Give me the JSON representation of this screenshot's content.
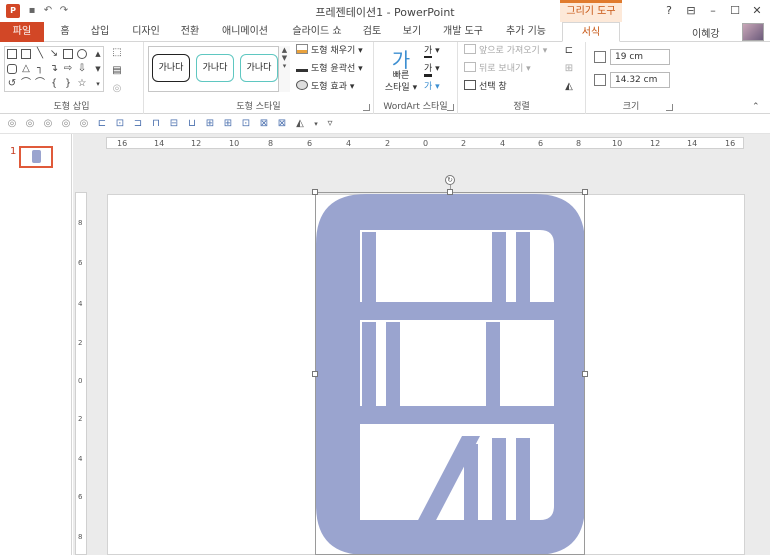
{
  "titlebar": {
    "app_icon": "P",
    "title": "프레젠테이션1 - PowerPoint",
    "context_tab_group": "그리기 도구",
    "help_icon": "?",
    "window_buttons": [
      "?",
      "⊟",
      "–",
      "☐",
      "✕"
    ]
  },
  "tabs": {
    "file": "파일",
    "items": [
      "홈",
      "삽입",
      "디자인",
      "전환",
      "애니메이션",
      "슬라이드 쇼",
      "검토",
      "보기",
      "개발 도구",
      "추가 기능",
      "서식"
    ],
    "active": "서식",
    "user": "이혜강"
  },
  "ribbon": {
    "insert_shapes": {
      "label": "도형 삽입"
    },
    "shape_styles": {
      "label": "도형 스타일",
      "thumbs": [
        "가나다",
        "가나다",
        "가나다"
      ],
      "fill": "도형 채우기",
      "outline": "도형 윤곽선",
      "effects": "도형 효과"
    },
    "wordart": {
      "label": "WordArt 스타일",
      "quick_style_line1": "빠른",
      "quick_style_line2": "스타일",
      "glyph": "가"
    },
    "arrange": {
      "label": "정렬",
      "bring_forward": "앞으로 가져오기",
      "send_backward": "뒤로 보내기",
      "selection_pane": "선택 창"
    },
    "size": {
      "label": "크기",
      "height": "19 cm",
      "width": "14.32 cm"
    }
  },
  "thumbnails": {
    "slide_number": "1"
  },
  "ruler": {
    "h_ticks": [
      "16",
      "14",
      "12",
      "10",
      "8",
      "6",
      "4",
      "2",
      "0",
      "2",
      "4",
      "6",
      "8",
      "10",
      "12",
      "14",
      "16"
    ],
    "v_ticks": [
      "8",
      "6",
      "4",
      "2",
      "0",
      "2",
      "4",
      "6",
      "8"
    ]
  },
  "colors": {
    "file_tab": "#d24726",
    "context_accent": "#e07b2e",
    "shape_fill": "#9aa4cf"
  },
  "icons": {
    "slide_shape": "bookshelf-icon"
  }
}
